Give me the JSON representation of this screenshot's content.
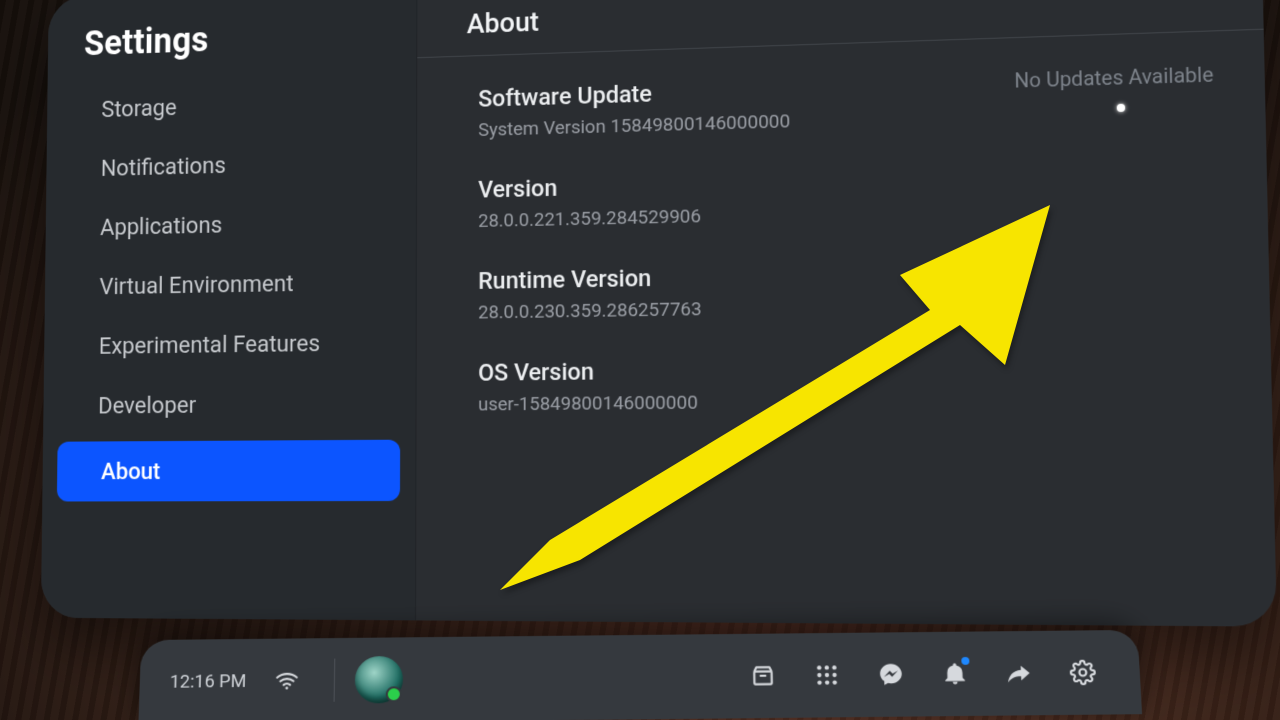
{
  "sidebar": {
    "title": "Settings",
    "items": [
      {
        "label": "Storage"
      },
      {
        "label": "Notifications"
      },
      {
        "label": "Applications"
      },
      {
        "label": "Virtual Environment"
      },
      {
        "label": "Experimental Features"
      },
      {
        "label": "Developer"
      },
      {
        "label": "About",
        "selected": true
      }
    ]
  },
  "content": {
    "title": "About",
    "update_status": "No Updates Available",
    "rows": [
      {
        "label": "Software Update",
        "sub": "System Version 15849800146000000"
      },
      {
        "label": "Version",
        "sub": "28.0.0.221.359.284529906"
      },
      {
        "label": "Runtime Version",
        "sub": "28.0.0.230.359.286257763"
      },
      {
        "label": "OS Version",
        "sub": "user-15849800146000000"
      }
    ]
  },
  "dock": {
    "time": "12:16 PM"
  }
}
